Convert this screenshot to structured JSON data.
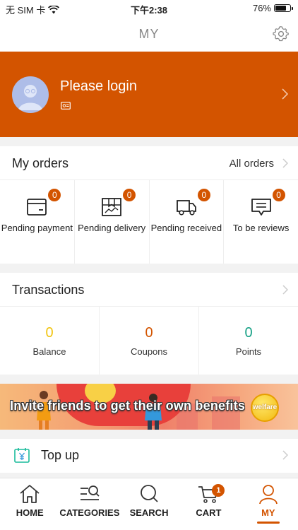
{
  "status_bar": {
    "carrier": "无 SIM 卡",
    "time": "下午2:38",
    "battery_percent": "76%",
    "battery_level": 0.76
  },
  "nav": {
    "title": "MY",
    "settings_icon": "gear-icon"
  },
  "login": {
    "prompt": "Please login",
    "avatar_icon": "default-avatar-icon",
    "id_icon": "id-card-icon"
  },
  "orders": {
    "title": "My orders",
    "all_link": "All orders",
    "items": [
      {
        "label": "Pending payment",
        "count": "0",
        "icon": "wallet-icon"
      },
      {
        "label": "Pending delivery",
        "count": "0",
        "icon": "package-icon"
      },
      {
        "label": "Pending received",
        "count": "0",
        "icon": "truck-icon"
      },
      {
        "label": "To be reviews",
        "count": "0",
        "icon": "review-icon"
      }
    ]
  },
  "transactions": {
    "title": "Transactions",
    "stats": [
      {
        "label": "Balance",
        "value": "0",
        "color": "#f1c40f"
      },
      {
        "label": "Coupons",
        "value": "0",
        "color": "#d35400"
      },
      {
        "label": "Points",
        "value": "0",
        "color": "#16a085"
      }
    ]
  },
  "promo": {
    "text": "Invite friends to get their own benefits",
    "badge": "welfare"
  },
  "topup": {
    "label": "Top up",
    "icon": "yen-card-icon"
  },
  "tabs": [
    {
      "label": "HOME",
      "icon": "home-icon"
    },
    {
      "label": "CATEGORIES",
      "icon": "category-search-icon"
    },
    {
      "label": "SEARCH",
      "icon": "search-icon"
    },
    {
      "label": "CART",
      "icon": "cart-icon",
      "badge": "1"
    },
    {
      "label": "MY",
      "icon": "user-icon",
      "active": true
    }
  ],
  "colors": {
    "accent": "#d35400",
    "balance": "#f1c40f",
    "coupons": "#d35400",
    "points": "#16a085"
  }
}
